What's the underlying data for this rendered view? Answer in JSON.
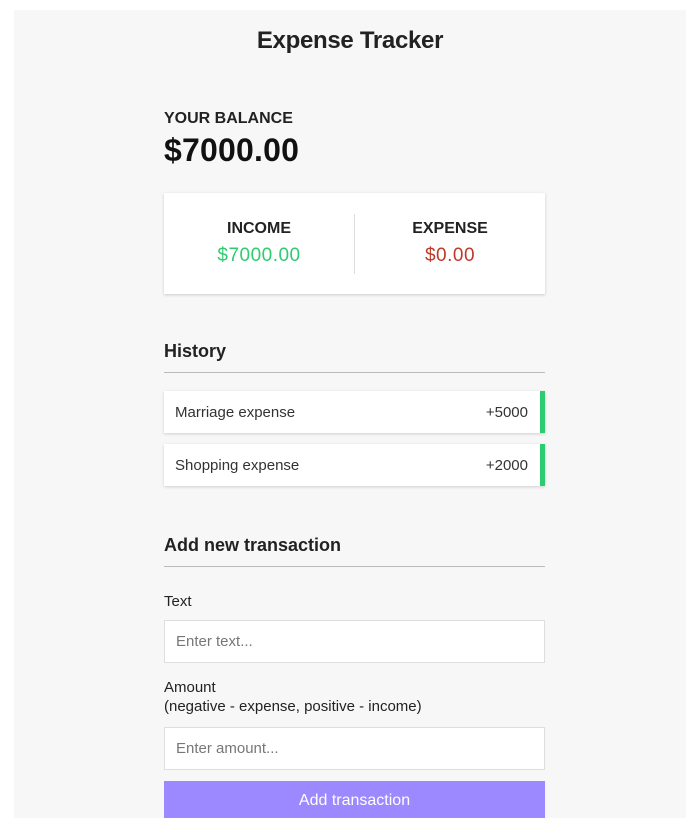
{
  "app": {
    "title": "Expense Tracker"
  },
  "balance": {
    "label": "YOUR BALANCE",
    "value": "$7000.00"
  },
  "summary": {
    "income_label": "INCOME",
    "income_value": "$7000.00",
    "expense_label": "EXPENSE",
    "expense_value": "$0.00"
  },
  "history": {
    "title": "History",
    "items": [
      {
        "text": "Marriage expense",
        "amount": "+5000",
        "type": "income"
      },
      {
        "text": "Shopping expense",
        "amount": "+2000",
        "type": "income"
      }
    ]
  },
  "form": {
    "title": "Add new transaction",
    "text_label": "Text",
    "text_placeholder": "Enter text...",
    "amount_label_line1": "Amount",
    "amount_label_line2": "(negative - expense, positive - income)",
    "amount_placeholder": "Enter amount...",
    "submit_label": "Add transaction"
  },
  "colors": {
    "income": "#2ecc71",
    "expense": "#c0392b",
    "button": "#9c88ff",
    "background": "#f7f7f7"
  }
}
